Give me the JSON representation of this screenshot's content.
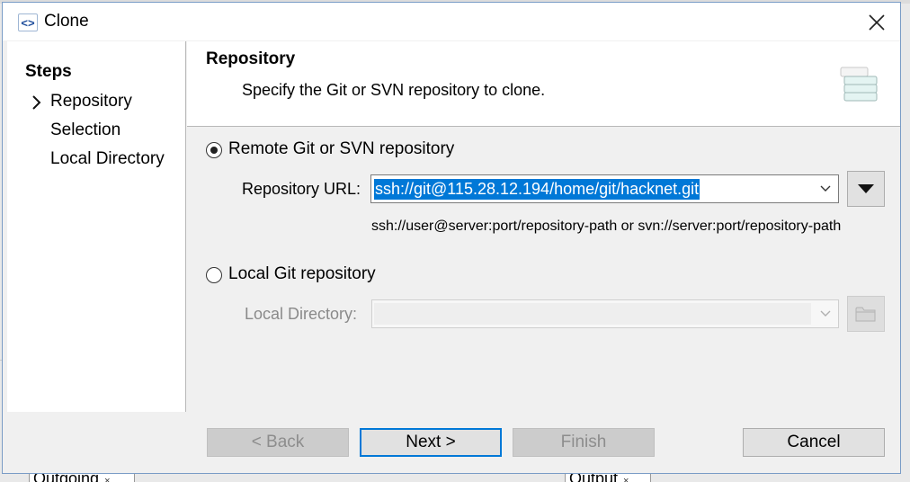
{
  "background": {
    "tab_outgoing": "Outgoing",
    "tab_output": "Output",
    "tab_close": "×"
  },
  "window": {
    "title": "Clone",
    "icon": "eclipse-clone-icon",
    "close": "close-icon"
  },
  "steps": {
    "title": "Steps",
    "items": [
      {
        "label": "Repository",
        "current": true
      },
      {
        "label": "Selection",
        "current": false
      },
      {
        "label": "Local Directory",
        "current": false
      }
    ]
  },
  "header": {
    "title": "Repository",
    "description": "Specify the Git or SVN repository to clone.",
    "icon": "repository-stack-icon"
  },
  "remote": {
    "label": "Remote Git or SVN repository",
    "selected": true,
    "url_label": "Repository URL:",
    "url_value": "ssh://git@115.28.12.194/home/git/hacknet.git",
    "hint": "ssh://user@server:port/repository-path or svn://server:port/repository-path"
  },
  "local": {
    "label": "Local Git repository",
    "selected": false,
    "dir_label": "Local Directory:",
    "dir_value": ""
  },
  "buttons": {
    "back": "< Back",
    "next": "Next >",
    "finish": "Finish",
    "cancel": "Cancel"
  },
  "colors": {
    "selection": "#0078d7",
    "dialog_bg": "#f0f0f0",
    "disabled_text": "#8d8d8d"
  }
}
